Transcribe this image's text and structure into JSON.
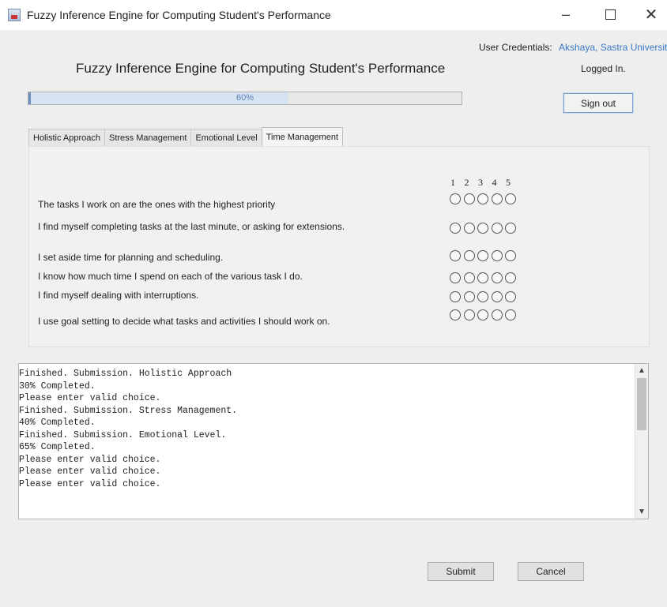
{
  "window": {
    "title": "Fuzzy Inference Engine for Computing Student's Performance",
    "minimize_glyph": "–",
    "close_glyph": "✕"
  },
  "header": {
    "heading": "Fuzzy Inference Engine for Computing Student's Performance",
    "credentials_label": "User Credentials:",
    "credentials_value": "Akshaya, Sastra University",
    "status": "Logged In.",
    "sign_out_label": "Sign out"
  },
  "progress": {
    "value": 60,
    "label": "60%"
  },
  "tabs": [
    {
      "label": "Holistic Approach"
    },
    {
      "label": "Stress Management"
    },
    {
      "label": "Emotional Level"
    },
    {
      "label": "Time Management",
      "active": true
    }
  ],
  "questionnaire": {
    "scale": [
      "1",
      "2",
      "3",
      "4",
      "5"
    ],
    "questions": [
      "The tasks I work on are the ones with the highest priority",
      "I find myself completing tasks at the last minute, or asking for extensions.",
      "I set aside time for planning and scheduling.",
      "I know how much time I spend on each of the various task I do.",
      "I find myself dealing with interruptions.",
      "I use goal setting to decide what tasks and activities I should work on."
    ]
  },
  "log": {
    "lines": [
      "Finished. Submission. Holistic Approach",
      "30% Completed.",
      "Please enter valid choice.",
      "Finished. Submission. Stress Management.",
      "40% Completed.",
      "Finished. Submission. Emotional Level.",
      "65% Completed.",
      "Please enter valid choice.",
      "Please enter valid choice.",
      "Please enter valid choice."
    ]
  },
  "buttons": {
    "submit_label": "Submit",
    "cancel_label": "Cancel"
  }
}
